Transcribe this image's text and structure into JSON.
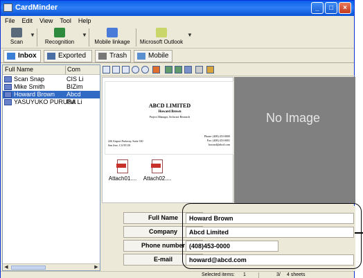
{
  "window": {
    "title": "CardMinder",
    "buttons": {
      "minimize": "_",
      "maximize": "□",
      "close": "×"
    }
  },
  "menu": [
    "File",
    "Edit",
    "View",
    "Tool",
    "Help"
  ],
  "toolbar": [
    {
      "label": "Scan",
      "icon": "scanner-icon"
    },
    {
      "label": "Recognition",
      "icon": "recognition-icon"
    },
    {
      "label": "Mobile linkage",
      "icon": "mobile-linkage-icon"
    },
    {
      "label": "Microsoft Outlook",
      "icon": "outlook-icon"
    }
  ],
  "folders": [
    {
      "label": "Inbox",
      "icon": "inbox-icon",
      "active": true
    },
    {
      "label": "Exported",
      "icon": "exported-icon"
    },
    {
      "label": "Trash",
      "icon": "trash-icon"
    },
    {
      "label": "Mobile",
      "icon": "mobile-icon"
    }
  ],
  "list": {
    "columns": [
      "Full Name",
      "Com"
    ],
    "rows": [
      {
        "name": "Scan Snap",
        "company": "CIS Li",
        "selected": false
      },
      {
        "name": "Mike Smith",
        "company": "BIZim",
        "selected": false
      },
      {
        "name": "Howard Brown",
        "company": "Abcd",
        "selected": true
      },
      {
        "name": "YASUYUKO PURUSA",
        "company": "Pul Li",
        "selected": false
      }
    ]
  },
  "card": {
    "company": "ABCD LIMITED",
    "person": "Howard Brown",
    "title": "Project Manager, Software Research",
    "address_line1": "226 Airport Parkway, Suite 330",
    "address_line2": "San Jose, CA 95110",
    "phone": "Phone: (408) 453-0000",
    "fax": "Fax: (408) 453-0001",
    "email": "howard@abcd.com"
  },
  "attachments": [
    "Attach01....",
    "Attach02...."
  ],
  "no_image": "No Image",
  "fields": [
    {
      "label": "Full Name",
      "value": "Howard Brown"
    },
    {
      "label": "Company",
      "value": "Abcd Limited"
    },
    {
      "label": "Phone number",
      "value": "(408)453-0000"
    },
    {
      "label": "E-mail",
      "value": "howard@abcd.com"
    }
  ],
  "status": {
    "selected": "Selected items:",
    "selected_count": "1",
    "page": "3/",
    "sheets": "4 sheets"
  },
  "colors": {
    "title_bar": "#0a5ee8",
    "selection": "#316ac5",
    "no_image_bg": "#808080"
  }
}
